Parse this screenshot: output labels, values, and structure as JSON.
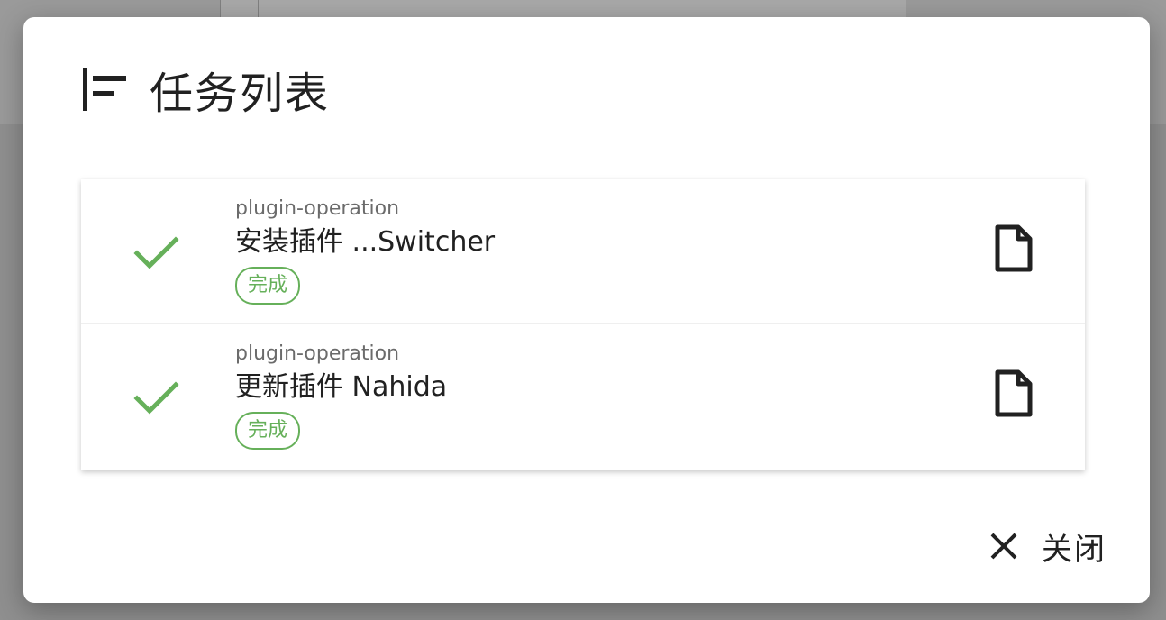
{
  "dialog": {
    "title": "任务列表",
    "title_icon": "sort-bars-icon",
    "tasks": [
      {
        "type": "plugin-operation",
        "title": "安装插件 ...Switcher",
        "status": "完成",
        "status_icon": "check-icon",
        "action_icon": "file-icon"
      },
      {
        "type": "plugin-operation",
        "title": "更新插件 Nahida",
        "status": "完成",
        "status_icon": "check-icon",
        "action_icon": "file-icon"
      }
    ],
    "close_label": "关闭",
    "close_icon": "close-icon"
  },
  "colors": {
    "success": "#66b05a",
    "text_primary": "#212121",
    "text_secondary": "#6b6b6b",
    "backdrop": "#8f8f8f"
  }
}
